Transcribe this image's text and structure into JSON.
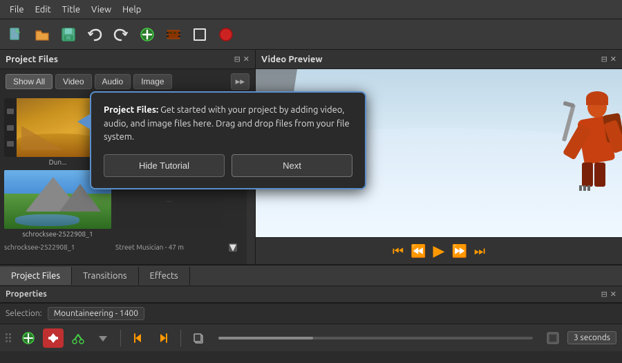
{
  "menubar": {
    "items": [
      "File",
      "Edit",
      "Title",
      "View",
      "Help"
    ]
  },
  "toolbar": {
    "buttons": [
      {
        "name": "new-file-btn",
        "icon": "📄",
        "label": "New"
      },
      {
        "name": "open-file-btn",
        "icon": "📂",
        "label": "Open"
      },
      {
        "name": "save-btn",
        "icon": "💾",
        "label": "Save"
      },
      {
        "name": "undo-btn",
        "icon": "↩",
        "label": "Undo"
      },
      {
        "name": "redo-btn",
        "icon": "↪",
        "label": "Redo"
      },
      {
        "name": "add-btn",
        "icon": "➕",
        "label": "Add"
      },
      {
        "name": "filmstrip-btn",
        "icon": "🎞",
        "label": "Film"
      },
      {
        "name": "fullscreen-btn",
        "icon": "⛶",
        "label": "Fullscreen"
      },
      {
        "name": "record-btn",
        "icon": "🔴",
        "label": "Record"
      }
    ]
  },
  "left_panel": {
    "title": "Project Files",
    "filter_buttons": [
      "Show All",
      "Video",
      "Audio",
      "Image"
    ],
    "files": [
      {
        "name": "Dun...",
        "type": "video"
      },
      {
        "name": "Street Musician - 47 m...",
        "type": "audio"
      },
      {
        "name": "schrocksee-2522908_1",
        "type": "image"
      }
    ]
  },
  "right_panel": {
    "title": "Video Preview"
  },
  "tutorial_popup": {
    "title": "Project Files:",
    "text": " Get started with your project by adding video, audio, and image files here. Drag and drop files from your file system.",
    "hide_label": "Hide Tutorial",
    "next_label": "Next"
  },
  "bottom_tabs": [
    {
      "label": "Project Files",
      "active": true
    },
    {
      "label": "Transitions",
      "active": false
    },
    {
      "label": "Effects",
      "active": false
    }
  ],
  "bottom_toolbar": {
    "duration_label": "3 seconds"
  },
  "selection_bar": {
    "label": "Selection:",
    "value": "Mountaineering - 1400"
  },
  "playback": {
    "buttons": [
      "⏮",
      "⏪",
      "▶",
      "⏩",
      "⏭"
    ]
  }
}
